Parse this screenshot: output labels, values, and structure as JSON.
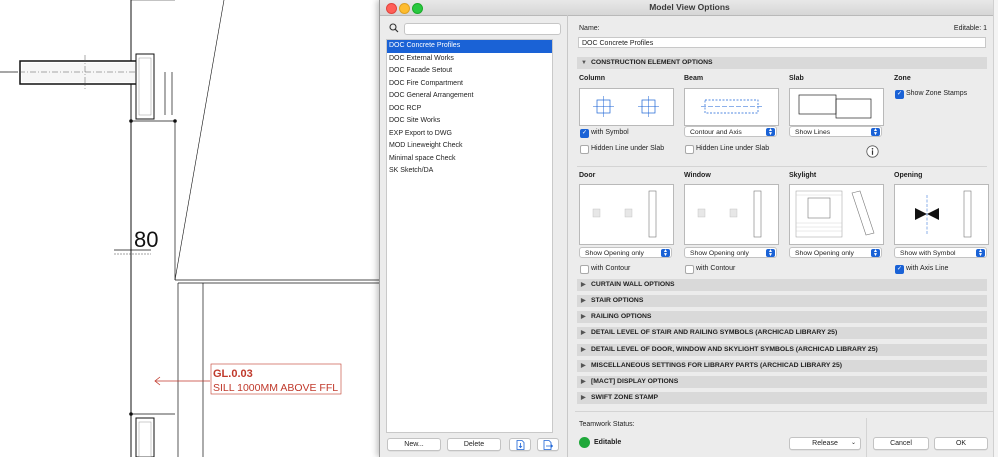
{
  "cad": {
    "dim_value": "80",
    "callout_line1": "GL.0.03",
    "callout_line2": "SILL 1000MM ABOVE FFL"
  },
  "window": {
    "title": "Model View Options"
  },
  "left_pane": {
    "search": {
      "value": "",
      "placeholder": ""
    },
    "items": [
      "DOC Concrete Profiles",
      "DOC External Works",
      "DOC Facade Setout",
      "DOC Fire Compartment",
      "DOC General Arrangement",
      "DOC RCP",
      "DOC Site Works",
      "EXP Export to DWG",
      "MOD Lineweight Check",
      "Minimal space Check",
      "SK Sketch/DA"
    ],
    "selected_index": 0,
    "new_label": "New...",
    "delete_label": "Delete"
  },
  "right_pane": {
    "name_label": "Name:",
    "editable_label": "Editable: 1",
    "name_value": "DOC Concrete Profiles",
    "construction_header": "CONSTRUCTION ELEMENT OPTIONS",
    "column": {
      "label": "Column",
      "with_symbol": {
        "label": "with Symbol",
        "checked": true
      },
      "hidden_line": {
        "label": "Hidden Line under Slab",
        "checked": false
      }
    },
    "beam": {
      "label": "Beam",
      "select": "Contour and Axis",
      "hidden_line": {
        "label": "Hidden Line under Slab",
        "checked": false
      }
    },
    "slab": {
      "label": "Slab",
      "select": "Show Lines"
    },
    "zone": {
      "label": "Zone",
      "stamps": {
        "label": "Show Zone Stamps",
        "checked": true
      }
    },
    "door": {
      "label": "Door",
      "select": "Show Opening only",
      "contour": {
        "label": "with Contour",
        "checked": false
      }
    },
    "window": {
      "label": "Window",
      "select": "Show Opening only",
      "contour": {
        "label": "with Contour",
        "checked": false
      }
    },
    "skylight": {
      "label": "Skylight",
      "select": "Show Opening only"
    },
    "opening": {
      "label": "Opening",
      "select": "Show with Symbol",
      "axis": {
        "label": "with Axis Line",
        "checked": true
      }
    },
    "sections": [
      "CURTAIN WALL OPTIONS",
      "STAIR OPTIONS",
      "RAILING OPTIONS",
      "DETAIL LEVEL OF STAIR AND RAILING SYMBOLS (ARCHICAD LIBRARY 25)",
      "DETAIL LEVEL OF DOOR, WINDOW AND SKYLIGHT SYMBOLS (ARCHICAD LIBRARY 25)",
      "MISCELLANEOUS SETTINGS FOR LIBRARY PARTS (ARCHICAD LIBRARY 25)",
      "[MACT] DISPLAY OPTIONS",
      "SWIFT ZONE STAMP"
    ],
    "teamwork_label": "Teamwork Status:",
    "teamwork_status": "Editable",
    "teamwork_color": "#1fa83a",
    "release_label": "Release",
    "cancel_label": "Cancel",
    "ok_label": "OK"
  },
  "colors": {
    "accent": "#1a62d6",
    "callout": "#c0392b"
  }
}
